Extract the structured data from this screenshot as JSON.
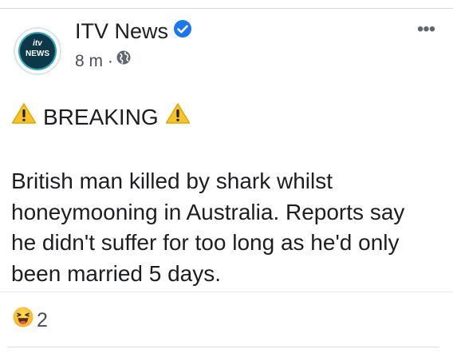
{
  "post": {
    "page_name": "ITV News",
    "avatar": {
      "logo_text": "itv",
      "word": "NEWS"
    },
    "time": "8 m",
    "separator": "·",
    "more_label": "•••",
    "breaking_label": "BREAKING",
    "body_lines": [
      "British man killed by shark whilst",
      "honeymooning in Australia. Reports say",
      "he didn't suffer for too long as he'd only",
      "been married 5 days."
    ],
    "reaction_count": "2",
    "icons": {
      "verified": "verified-badge-icon",
      "audience": "globe-icon",
      "warning": "warning-icon",
      "reaction": "haha-emoji-icon"
    }
  },
  "colors": {
    "brand_teal": "#30a6b9",
    "brand_navy": "#0d3848",
    "verified_blue": "#1877f2",
    "warning_yellow": "#f7c325",
    "text": "#1c1e21",
    "secondary_text": "#4b4f56"
  }
}
